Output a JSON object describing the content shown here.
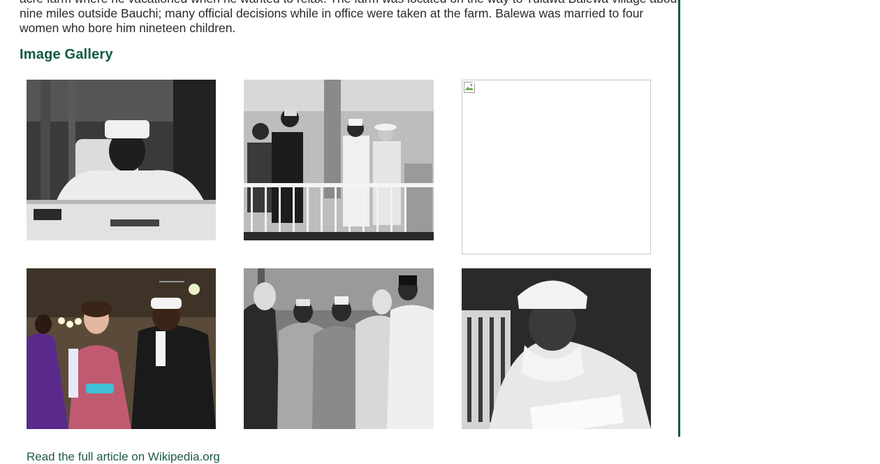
{
  "article": {
    "lines": [
      "acre farm where he vacationed when he wanted to relax. The farm was located on the way to Tulawa Balewa village about",
      "nine miles outside Bauchi; many official decisions while in office were taken at the farm. Balewa was married to four",
      "women who bore him nineteen children."
    ]
  },
  "gallery": {
    "title": "Image Gallery",
    "images": [
      {
        "icon": "photo-man-at-desk"
      },
      {
        "icon": "photo-group-on-balcony"
      },
      {
        "icon": "broken-image-icon"
      },
      {
        "icon": "photo-color-reception"
      },
      {
        "icon": "photo-group-handshake"
      },
      {
        "icon": "photo-portrait-turban"
      }
    ]
  },
  "footer": {
    "link_label": "Read the full article on Wikipedia.org"
  },
  "colors": {
    "accent": "#0f5a3c",
    "link": "#1e5a45",
    "text": "#2a2a2a"
  }
}
